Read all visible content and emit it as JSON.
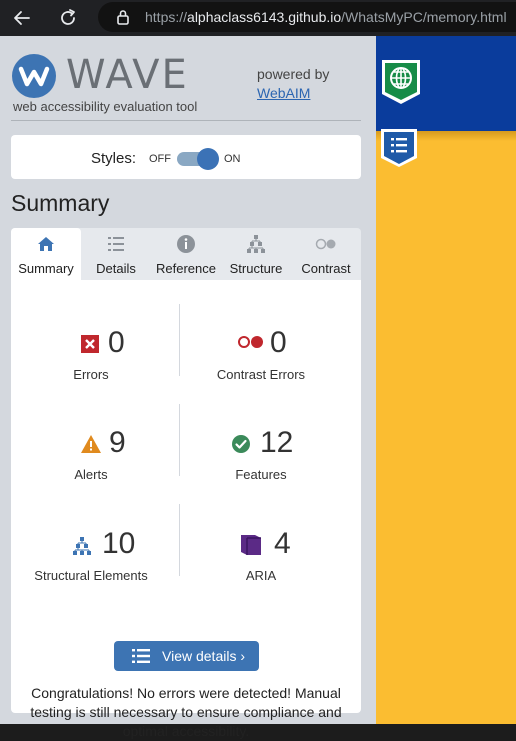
{
  "browser": {
    "url_scheme": "https://",
    "url_host": "alphaclass6143.github.io",
    "url_path": "/WhatsMyPC/memory.html"
  },
  "wave": {
    "logo_word": "WAVE",
    "tagline": "web accessibility evaluation tool",
    "powered_by": "powered by",
    "webaim_link": "WebAIM"
  },
  "styles": {
    "label": "Styles:",
    "off": "OFF",
    "on": "ON",
    "enabled": true
  },
  "summary_heading": "Summary",
  "tabs": [
    {
      "label": "Summary",
      "icon": "home-icon",
      "active": true
    },
    {
      "label": "Details",
      "icon": "list-icon",
      "active": false
    },
    {
      "label": "Reference",
      "icon": "info-icon",
      "active": false
    },
    {
      "label": "Structure",
      "icon": "structure-icon",
      "active": false
    },
    {
      "label": "Contrast",
      "icon": "contrast-icon",
      "active": false
    }
  ],
  "stats": {
    "errors": {
      "count": "0",
      "label": "Errors",
      "color": "#c0272d"
    },
    "contrast_errors": {
      "count": "0",
      "label": "Contrast Errors",
      "color": "#c0272d"
    },
    "alerts": {
      "count": "9",
      "label": "Alerts",
      "color": "#e08a1e"
    },
    "features": {
      "count": "12",
      "label": "Features",
      "color": "#3b8a5a"
    },
    "structural": {
      "count": "10",
      "label": "Structural Elements",
      "color": "#3d74b3"
    },
    "aria": {
      "count": "4",
      "label": "ARIA",
      "color": "#5b2a86"
    }
  },
  "view_details_label": "View details ›",
  "congrats_message": "Congratulations! No errors were detected! Manual testing is still necessary to ensure compliance and optimal accessibility.",
  "colors": {
    "accent": "#3d74b3",
    "panel_bg": "#d4d8de",
    "page_yellow": "#fbbd31",
    "page_blue": "#0a3c9c"
  }
}
